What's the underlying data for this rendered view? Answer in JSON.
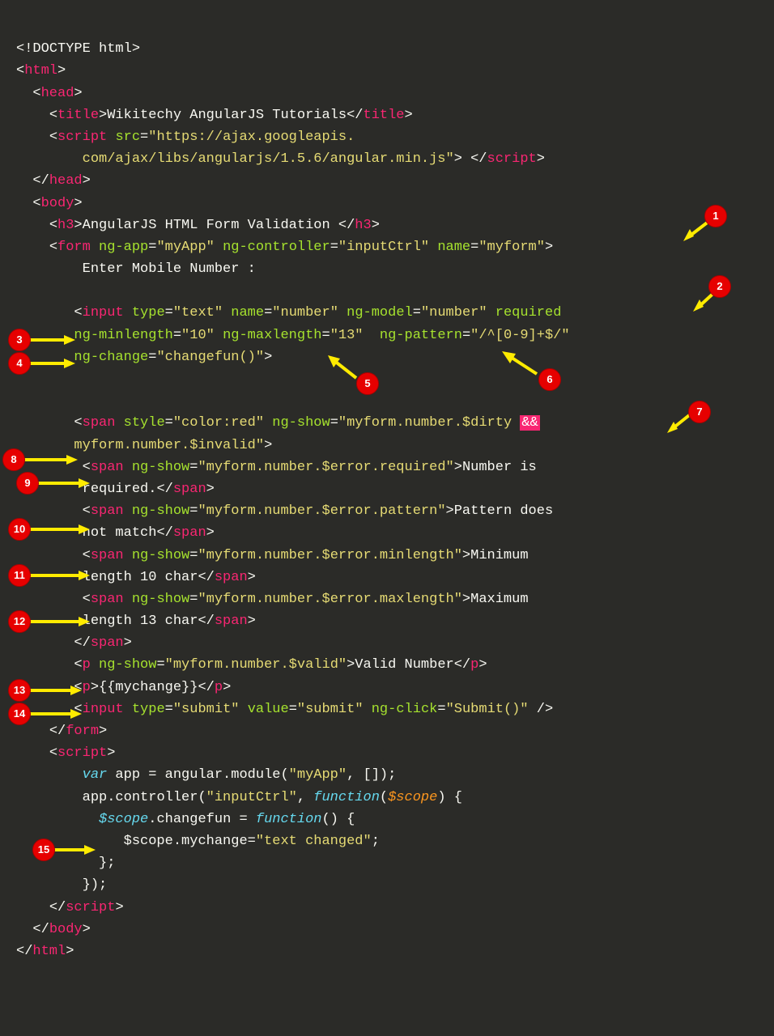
{
  "code": {
    "l01": "<!DOCTYPE html>",
    "l02_open": "<",
    "l02_tag": "html",
    "l02_close": ">",
    "l03_open": "<",
    "l03_tag": "head",
    "l03_close": ">",
    "l04_open": "<",
    "l04_tag": "title",
    "l04_close": ">",
    "l04_text": "Wikitechy AngularJS Tutorials",
    "l04_open2": "</",
    "l04_close2": ">",
    "l05_open": "<",
    "l05_tag": "script",
    "l05_sp": " ",
    "l05_attr": "src",
    "l05_eq": "=",
    "l05_str": "\"https://ajax.googleapis.",
    "l06_str": "com/ajax/libs/angularjs/1.5.6/angular.min.js\"",
    "l06_close": "> </",
    "l06_tag": "script",
    "l06_close2": ">",
    "l07_open": "</",
    "l07_tag": "head",
    "l07_close": ">",
    "l08_open": "<",
    "l08_tag": "body",
    "l08_close": ">",
    "l09_open": "<",
    "l09_tag": "h3",
    "l09_close": ">",
    "l09_text": "AngularJS HTML Form Validation ",
    "l09_open2": "</",
    "l09_close2": ">",
    "l10_open": "<",
    "l10_tag": "form",
    "l10_a1": "ng-app",
    "l10_v1": "\"myApp\"",
    "l10_a2": "ng-controller",
    "l10_v2": "\"inputCtrl\"",
    "l10_a3": "name",
    "l10_v3": "\"myform\"",
    "l10_close": ">",
    "l11_text": "Enter Mobile Number :",
    "l12_open": "<",
    "l12_tag": "input",
    "l12_a1": "type",
    "l12_v1": "\"text\"",
    "l12_a2": "name",
    "l12_v2": "\"number\"",
    "l12_a3": "ng-model",
    "l12_v3": "\"number\"",
    "l12_a4": "required",
    "l13_a1": "ng-minlength",
    "l13_v1": "\"10\"",
    "l13_a2": "ng-maxlength",
    "l13_v2": "\"13\"",
    "l13_a3": "ng-pattern",
    "l13_v3": "\"/^[0-9]+$/\"",
    "l14_a1": "ng-change",
    "l14_v1": "\"changefun()\"",
    "l14_close": ">",
    "l15_open": "<",
    "l15_tag": "span",
    "l15_a1": "style",
    "l15_v1": "\"color:red\"",
    "l15_a2": "ng-show",
    "l15_v2": "\"myform.number.$dirty ",
    "l15_amp": "&&",
    "l16_text": "myform.number.$invalid\"",
    "l16_close": ">",
    "l17_open": "<",
    "l17_tag": "span",
    "l17_a1": "ng-show",
    "l17_v1": "\"myform.number.$error.required\"",
    "l17_close": ">",
    "l17_text": "Number is",
    "l18_text": "required.",
    "l18_open": "</",
    "l18_tag": "span",
    "l18_close": ">",
    "l19_open": "<",
    "l19_tag": "span",
    "l19_a1": "ng-show",
    "l19_v1": "\"myform.number.$error.pattern\"",
    "l19_close": ">",
    "l19_text": "Pattern does",
    "l20_text": "not match",
    "l20_open": "</",
    "l20_tag": "span",
    "l20_close": ">",
    "l21_open": "<",
    "l21_tag": "span",
    "l21_a1": "ng-show",
    "l21_v1": "\"myform.number.$error.minlength\"",
    "l21_close": ">",
    "l21_text": "Minimum",
    "l22_text": "length 10 char",
    "l22_open": "</",
    "l22_tag": "span",
    "l22_close": ">",
    "l23_open": "<",
    "l23_tag": "span",
    "l23_a1": "ng-show",
    "l23_v1": "\"myform.number.$error.maxlength\"",
    "l23_close": ">",
    "l23_text": "Maximum",
    "l24_text": "length 13 char",
    "l24_open": "</",
    "l24_tag": "span",
    "l24_close": ">",
    "l25_open": "</",
    "l25_tag": "span",
    "l25_close": ">",
    "l26_open": "<",
    "l26_tag": "p",
    "l26_a1": "ng-show",
    "l26_v1": "\"myform.number.$valid\"",
    "l26_close": ">",
    "l26_text": "Valid Number",
    "l26_open2": "</",
    "l26_close2": ">",
    "l27_open": "<",
    "l27_tag": "p",
    "l27_close": ">",
    "l27_text": "{{mychange}}",
    "l27_open2": "</",
    "l27_close2": ">",
    "l28_open": "<",
    "l28_tag": "input",
    "l28_a1": "type",
    "l28_v1": "\"submit\"",
    "l28_a2": "value",
    "l28_v2": "\"submit\"",
    "l28_a3": "ng-click",
    "l28_v3": "\"Submit()\"",
    "l28_close": " />",
    "l29_open": "</",
    "l29_tag": "form",
    "l29_close": ">",
    "l30_open": "<",
    "l30_tag": "script",
    "l30_close": ">",
    "l31_kw": "var",
    "l31_text": " app = angular.module(",
    "l31_str": "\"myApp\"",
    "l31_text2": ", []);",
    "l32_text": "app.controller(",
    "l32_str": "\"inputCtrl\"",
    "l32_text2": ", ",
    "l32_fn": "function",
    "l32_text3": "(",
    "l32_param": "$scope",
    "l32_text4": ") {",
    "l33_scope": "$scope",
    "l33_text": ".changefun = ",
    "l33_fn": "function",
    "l33_text2": "() {",
    "l34_text": "$scope.mychange=",
    "l34_str": "\"text changed\"",
    "l34_text2": ";",
    "l35_text": "};",
    "l36_text": "});",
    "l37_open": "</",
    "l37_tag": "script",
    "l37_close": ">",
    "l38_open": "</",
    "l38_tag": "body",
    "l38_close": ">",
    "l39_open": "</",
    "l39_tag": "html",
    "l39_close": ">"
  },
  "badges": {
    "b1": "1",
    "b2": "2",
    "b3": "3",
    "b4": "4",
    "b5": "5",
    "b6": "6",
    "b7": "7",
    "b8": "8",
    "b9": "9",
    "b10": "10",
    "b11": "11",
    "b12": "12",
    "b13": "13",
    "b14": "14",
    "b15": "15"
  }
}
